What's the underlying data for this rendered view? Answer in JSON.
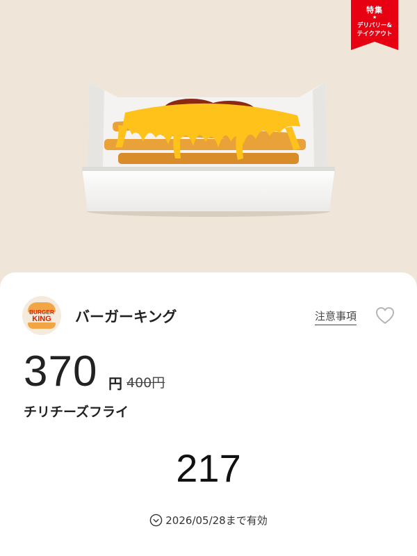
{
  "banner": {
    "title": "特集",
    "star": "★",
    "line1": "デリバリー&",
    "line2": "テイクアウト",
    "color": "#e60012"
  },
  "hero": {
    "image": "chili-cheese-fries-photo"
  },
  "store": {
    "logo_top": "BURGER",
    "logo_bottom": "KING",
    "name": "バーガーキング"
  },
  "actions": {
    "notes_label": "注意事項",
    "favorite_icon": "heart-outline-icon"
  },
  "coupon": {
    "price": "370",
    "price_unit": "円",
    "original_price": "400円",
    "product": "チリチーズフライ",
    "code": "217",
    "expiry": "2026/05/28まで有効"
  }
}
